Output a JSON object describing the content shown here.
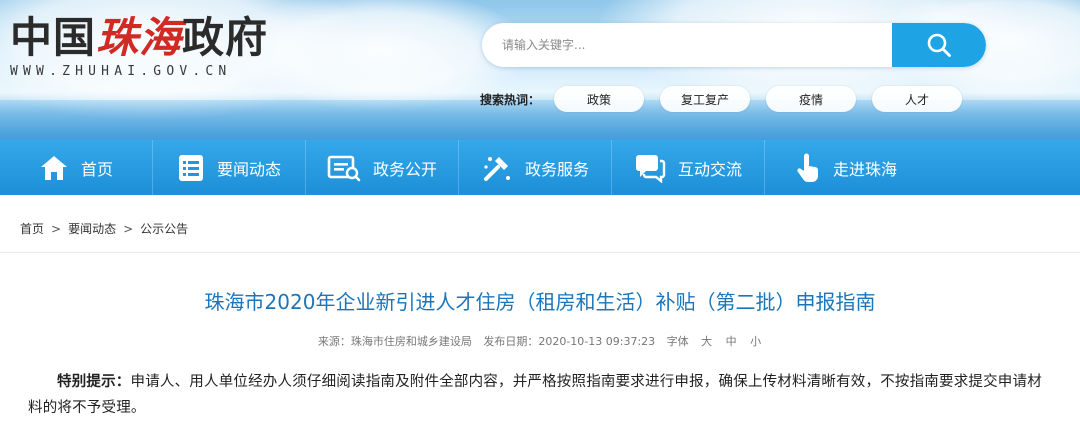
{
  "site": {
    "name_part1": "中国",
    "name_part2": "珠海",
    "name_part3": "政府",
    "url": "WWW.ZHUHAI.GOV.CN"
  },
  "search": {
    "placeholder": "请输入关键字...",
    "hot_label": "搜索热词：",
    "hot_tags": [
      "政策",
      "复工复产",
      "疫情",
      "人才"
    ]
  },
  "nav": {
    "items": [
      {
        "label": "首页",
        "icon": "home-icon"
      },
      {
        "label": "要闻动态",
        "icon": "list-icon"
      },
      {
        "label": "政务公开",
        "icon": "document-icon"
      },
      {
        "label": "政务服务",
        "icon": "tools-icon"
      },
      {
        "label": "互动交流",
        "icon": "chat-icon"
      },
      {
        "label": "走进珠海",
        "icon": "hand-pointer-icon"
      }
    ]
  },
  "breadcrumb": {
    "items": [
      "首页",
      "要闻动态",
      "公示公告"
    ],
    "separator": ">"
  },
  "article": {
    "title": "珠海市2020年企业新引进人才住房（租房和生活）补贴（第二批）申报指南",
    "source": "来源：珠海市住房和城乡建设局",
    "published": "发布日期：2020-10-13 09:37:23",
    "font_label": "字体",
    "font_sizes": [
      "大",
      "中",
      "小"
    ],
    "notice_label": "特别提示：",
    "notice_text": "申请人、用人单位经办人须仔细阅读指南及附件全部内容，并严格按照指南要求进行申报，确保上传材料清晰有效，不按指南要求提交申请材料的将不予受理。"
  },
  "colors": {
    "nav_blue": "#1c8fd8",
    "search_button": "#1ea4e4",
    "title_blue": "#1b76b9",
    "logo_red": "#d12a24"
  }
}
